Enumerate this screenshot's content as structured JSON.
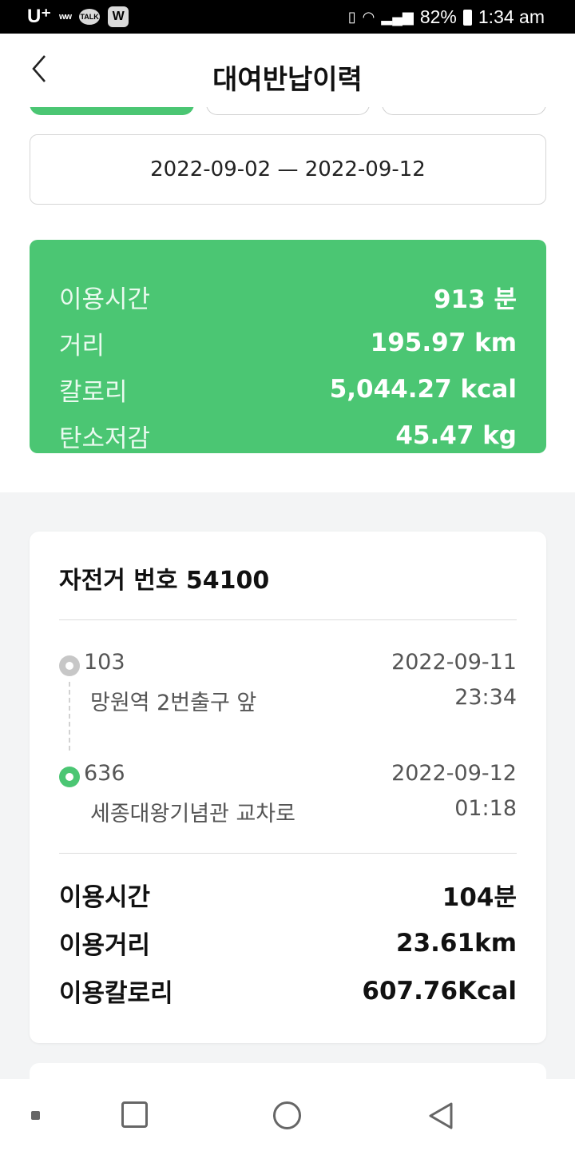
{
  "status_bar": {
    "carrier": "U⁺",
    "mini_label": "ᴡᴡ",
    "talk_badge": "TALK",
    "w_badge": "W",
    "vibrate_icon": "vibrate-icon",
    "wifi_icon": "wifi-icon",
    "signal_icon": "signal-icon",
    "battery_percent": "82%",
    "time": "1:34 am"
  },
  "header": {
    "title": "대여반납이력",
    "back_icon": "chevron-left-icon"
  },
  "filter": {
    "date_range": "2022-09-02 — 2022-09-12"
  },
  "summary": {
    "rows": [
      {
        "label": "이용시간",
        "value": "913 분"
      },
      {
        "label": "거리",
        "value": "195.97 km"
      },
      {
        "label": "칼로리",
        "value": "5,044.27 kcal"
      },
      {
        "label": "탄소저감",
        "value": "45.47 kg"
      }
    ]
  },
  "rental": {
    "title": "자전거 번호 54100",
    "start": {
      "number": "103",
      "name": "망원역 2번출구 앞",
      "date": "2022-09-11",
      "time": "23:34"
    },
    "end": {
      "number": "636",
      "name": "세종대왕기념관 교차로",
      "date": "2022-09-12",
      "time": "01:18"
    },
    "usage": [
      {
        "label": "이용시간",
        "value": "104분"
      },
      {
        "label": "이용거리",
        "value": "23.61km"
      },
      {
        "label": "이용칼로리",
        "value": "607.76Kcal"
      }
    ]
  },
  "colors": {
    "accent": "#4bc673",
    "background": "#f3f4f5"
  }
}
